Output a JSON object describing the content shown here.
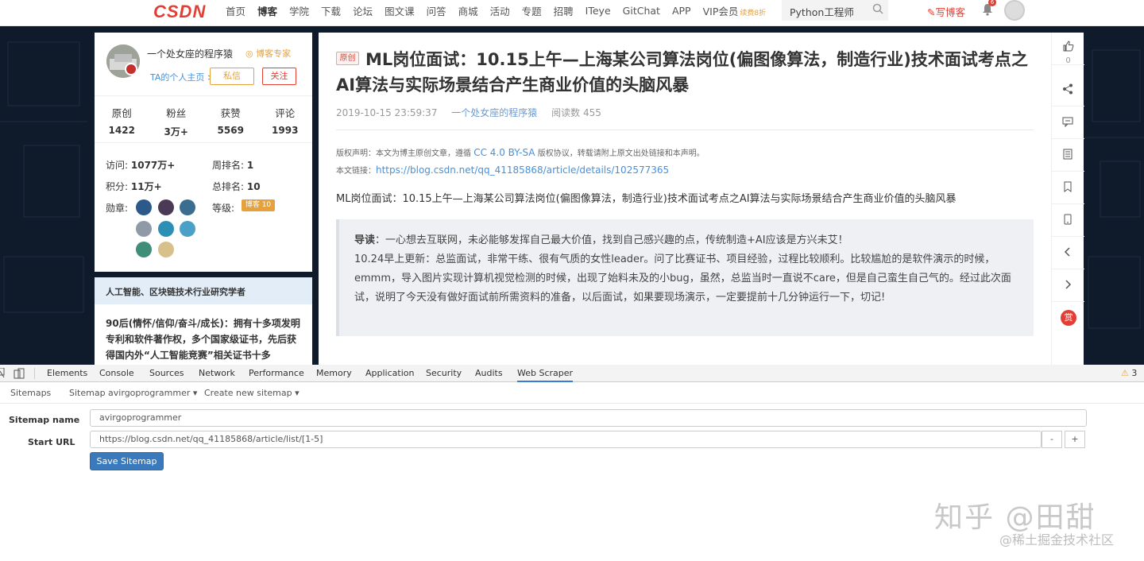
{
  "topnav": {
    "logo": "CSDN",
    "items": [
      {
        "label": "首页",
        "active": false
      },
      {
        "label": "博客",
        "active": true
      },
      {
        "label": "学院",
        "active": false
      },
      {
        "label": "下载",
        "active": false
      },
      {
        "label": "论坛",
        "active": false
      },
      {
        "label": "图文课",
        "active": false
      },
      {
        "label": "问答",
        "active": false
      },
      {
        "label": "商城",
        "active": false
      },
      {
        "label": "活动",
        "active": false
      },
      {
        "label": "专题",
        "active": false
      },
      {
        "label": "招聘",
        "active": false
      },
      {
        "label": "ITeye",
        "active": false
      },
      {
        "label": "GitChat",
        "active": false
      },
      {
        "label": "APP",
        "active": false
      }
    ],
    "vip_label": "VIP会员",
    "vip_badge": "续费8折",
    "search_value": "Python工程师",
    "write_label": "写博客",
    "notification_count": "6"
  },
  "profile": {
    "username": "一个处女座的程序猿",
    "expert_label": "博客专家",
    "home_link": "TA的个人主页 >",
    "message_button": "私信",
    "follow_button": "关注",
    "stats": [
      {
        "label": "原创",
        "value": "1422"
      },
      {
        "label": "粉丝",
        "value": "3万+"
      },
      {
        "label": "获赞",
        "value": "5569"
      },
      {
        "label": "评论",
        "value": "1993"
      }
    ],
    "visits_label": "访问:",
    "visits_value": "1077万+",
    "week_rank_label": "周排名:",
    "week_rank_value": "1",
    "points_label": "积分:",
    "points_value": "11万+",
    "total_rank_label": "总排名:",
    "total_rank_value": "10",
    "medals_label": "勋章:",
    "level_label": "等级:",
    "level_badge": "博客 10"
  },
  "ai_card": {
    "header": "人工智能、区块链技术行业研究学者",
    "body": "90后(情怀/信仰/奋斗/成长)：拥有十多项发明专利和软件著作权，多个国家级证书，先后获得国内外“人工智能竞赛”相关证书十多"
  },
  "article": {
    "original_tag": "原创",
    "title": "ML岗位面试：10.15上午—上海某公司算法岗位(偏图像算法，制造行业)技术面试考点之AI算法与实际场景结合产生商业价值的头脑风暴",
    "date": "2019-10-15 23:59:37",
    "author": "一个处女座的程序猿",
    "reads": "阅读数 455",
    "copyright_prefix": "版权声明：本文为博主原创文章，遵循",
    "license": "CC 4.0 BY-SA",
    "copyright_suffix": "版权协议，转载请附上原文出处链接和本声明。",
    "link_label": "本文链接：",
    "link_url": "https://blog.csdn.net/qq_41185868/article/details/102577365",
    "intro_line": "ML岗位面试：10.15上午—上海某公司算法岗位(偏图像算法，制造行业)技术面试考点之AI算法与实际场景结合产生商业价值的头脑风暴",
    "quote_lead": "导读",
    "quote_line1": "：一心想去互联网，未必能够发挥自己最大价值，找到自己感兴趣的点，传统制造+AI应该是方兴未艾！",
    "quote_rest": "10.24早上更新：总监面试，非常干练、很有气质的女性leader。问了比赛证书、项目经验，过程比较顺利。比较尴尬的是软件演示的时候，emmm，导入图片实现计算机视觉检测的时候，出现了始料未及的小bug，虽然，总监当时一直说不care，但是自己蛮生自己气的。经过此次面试，说明了今天没有做好面试前所需资料的准备，以后面试，如果要现场演示，一定要提前十几分钟运行一下，切记!"
  },
  "toolbar": {
    "like_count": "0",
    "reward_label": "赏"
  },
  "devtools": {
    "tabs": [
      {
        "label": "Elements"
      },
      {
        "label": "Console"
      },
      {
        "label": "Sources"
      },
      {
        "label": "Network"
      },
      {
        "label": "Performance"
      },
      {
        "label": "Memory"
      },
      {
        "label": "Application"
      },
      {
        "label": "Security"
      },
      {
        "label": "Audits"
      },
      {
        "label": "Web Scraper"
      }
    ],
    "active_tab": "Web Scraper",
    "warning_count": "3"
  },
  "webscraper": {
    "nav_sitemaps": "Sitemaps",
    "nav_current": "Sitemap avirgoprogrammer",
    "nav_create": "Create new sitemap",
    "sitemap_name_label": "Sitemap name",
    "sitemap_name_value": "avirgoprogrammer",
    "start_url_label": "Start URL",
    "start_url_value": "https://blog.csdn.net/qq_41185868/article/list/[1-5]",
    "minus_label": "-",
    "plus_label": "+",
    "save_button": "Save Sitemap"
  },
  "watermark": {
    "line1": "知乎 @田甜",
    "line2": "@稀土掘金技术社区"
  },
  "colors": {
    "csdn_red": "#e33e33",
    "dark_bg": "#0f1b2a",
    "link_blue": "#4a90d9",
    "save_button": "#3a7abc"
  }
}
